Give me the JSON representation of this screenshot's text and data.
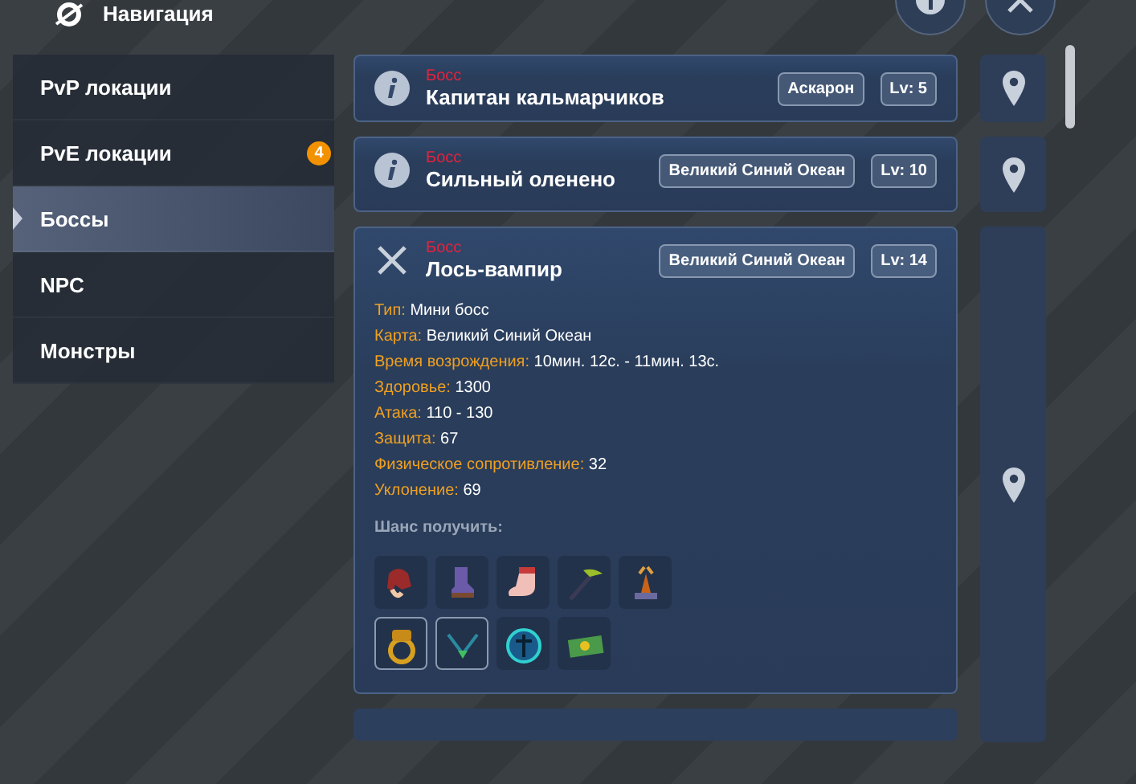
{
  "header": {
    "title": "Навигация"
  },
  "sidebar": {
    "items": [
      {
        "label": "PvP локации",
        "selected": false
      },
      {
        "label": "PvE локации",
        "selected": false,
        "badge": "4"
      },
      {
        "label": "Боссы",
        "selected": true
      },
      {
        "label": "NPC",
        "selected": false
      },
      {
        "label": "Монстры",
        "selected": false
      }
    ]
  },
  "bosses": [
    {
      "category": "Босс",
      "name": "Капитан кальмарчиков",
      "location": "Аскарон",
      "level": "Lv: 5",
      "expanded": false
    },
    {
      "category": "Босс",
      "name": "Сильный оленено",
      "location": "Великий Синий Океан",
      "level": "Lv: 10",
      "expanded": false
    },
    {
      "category": "Босс",
      "name": "Лось-вампир",
      "location": "Великий Синий Океан",
      "level": "Lv: 14",
      "expanded": true,
      "stats": [
        {
          "label": "Тип:",
          "value": "Мини босс"
        },
        {
          "label": "Карта:",
          "value": "Великий Синий Океан"
        },
        {
          "label": "Время возрождения:",
          "value": "10мин. 12с. - 11мин. 13с."
        },
        {
          "label": "Здоровье:",
          "value": "1300"
        },
        {
          "label": "Атака:",
          "value": "110 - 130"
        },
        {
          "label": "Защита:",
          "value": "67"
        },
        {
          "label": "Физическое сопротивление:",
          "value": "32"
        },
        {
          "label": "Уклонение:",
          "value": "69"
        }
      ],
      "drops_label": "Шанс получить:",
      "drops": [
        {
          "kind": "hat",
          "framed": false
        },
        {
          "kind": "boot",
          "framed": false
        },
        {
          "kind": "sock",
          "framed": false
        },
        {
          "kind": "hoe",
          "framed": false
        },
        {
          "kind": "trophy",
          "framed": false
        },
        {
          "kind": "ring",
          "framed": true
        },
        {
          "kind": "necklace",
          "framed": true
        },
        {
          "kind": "emblem",
          "framed": false
        },
        {
          "kind": "banknote",
          "framed": false
        }
      ]
    }
  ]
}
